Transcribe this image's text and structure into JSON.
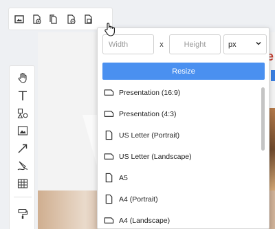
{
  "top_toolbar": {
    "icons": [
      "image-icon",
      "page-add-icon",
      "page-copy-icon",
      "page-delete-icon",
      "page-resize-icon"
    ]
  },
  "side_toolbar": {
    "icons": [
      "hand-pan-icon",
      "text-icon",
      "shapes-icon",
      "image-icon",
      "arrow-line-icon",
      "pen-draw-icon",
      "table-icon",
      "paint-format-icon"
    ]
  },
  "resize_popup": {
    "width_placeholder": "Width",
    "separator": "x",
    "height_placeholder": "Height",
    "unit_selected": "px",
    "resize_label": "Resize",
    "presets": [
      {
        "label": "Presentation (16:9)",
        "orientation": "landscape"
      },
      {
        "label": "Presentation (4:3)",
        "orientation": "landscape"
      },
      {
        "label": "US Letter (Portrait)",
        "orientation": "portrait"
      },
      {
        "label": "US Letter (Landscape)",
        "orientation": "landscape"
      },
      {
        "label": "A5",
        "orientation": "portrait"
      },
      {
        "label": "A4 (Portrait)",
        "orientation": "portrait"
      },
      {
        "label": "A4 (Landscape)",
        "orientation": "landscape"
      }
    ]
  },
  "colors": {
    "accent": "#4a90f0",
    "canvas_bg": "#f3f3f3"
  }
}
